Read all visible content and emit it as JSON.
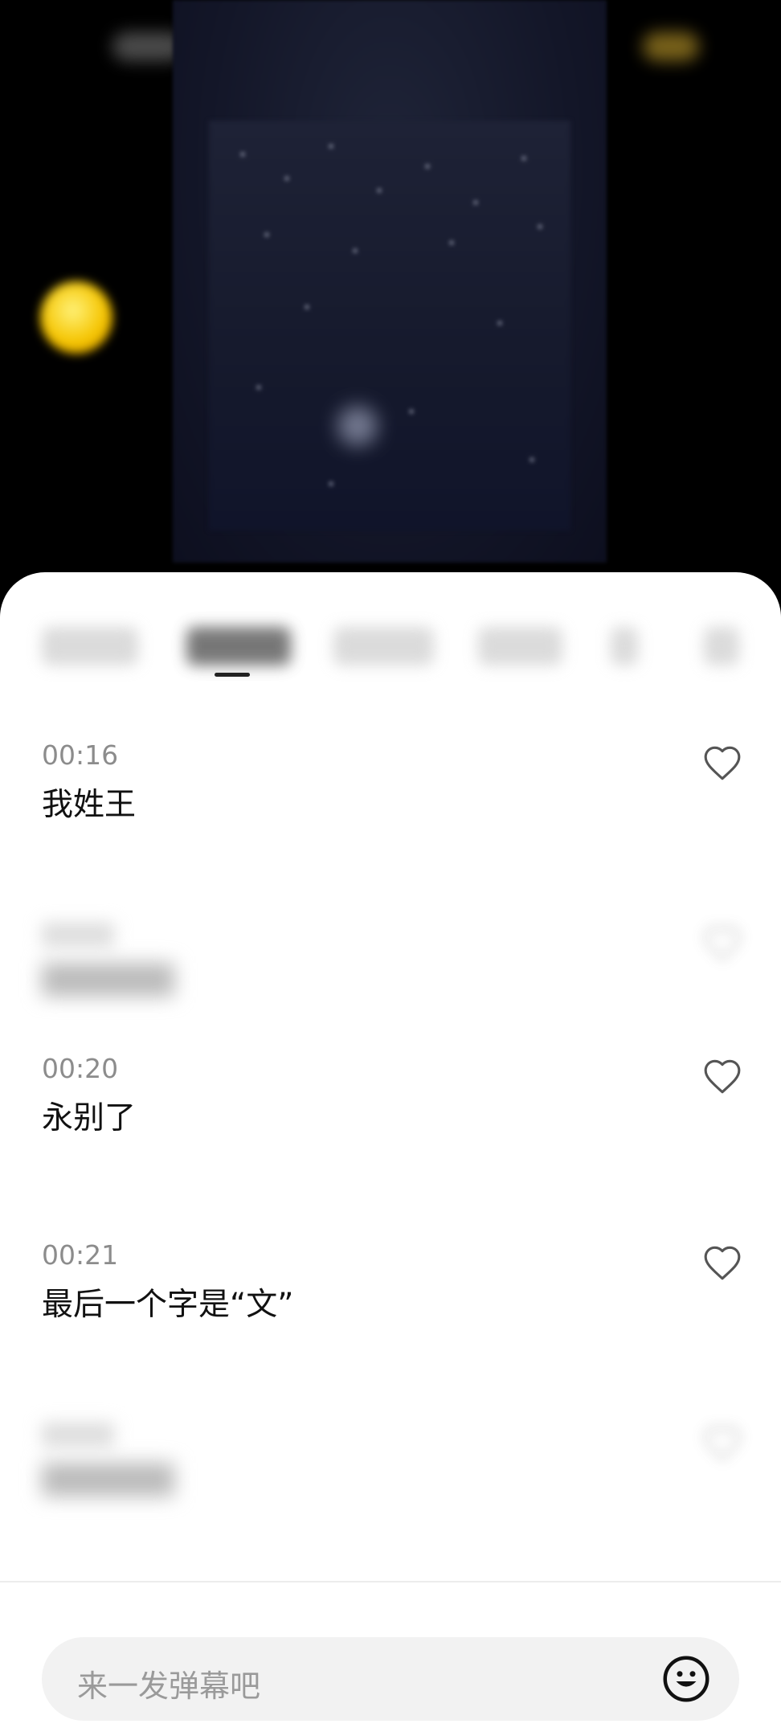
{
  "danmaku_list": {
    "items": [
      {
        "time": "00:16",
        "text": "我姓王",
        "like_icon": "heart-icon"
      },
      {
        "time": "",
        "text": "",
        "like_icon": "heart-icon"
      },
      {
        "time": "00:20",
        "text": "永别了",
        "like_icon": "heart-icon"
      },
      {
        "time": "00:21",
        "text": "最后一个字是“文”",
        "like_icon": "heart-icon"
      },
      {
        "time": "",
        "text": "",
        "like_icon": "heart-icon"
      }
    ]
  },
  "input_bar": {
    "placeholder": "来一发弹幕吧",
    "emoji_icon": "smiley-icon"
  },
  "colors": {
    "accent": "#222222",
    "sheet_background": "#ffffff",
    "input_background": "#f2f2f2"
  }
}
